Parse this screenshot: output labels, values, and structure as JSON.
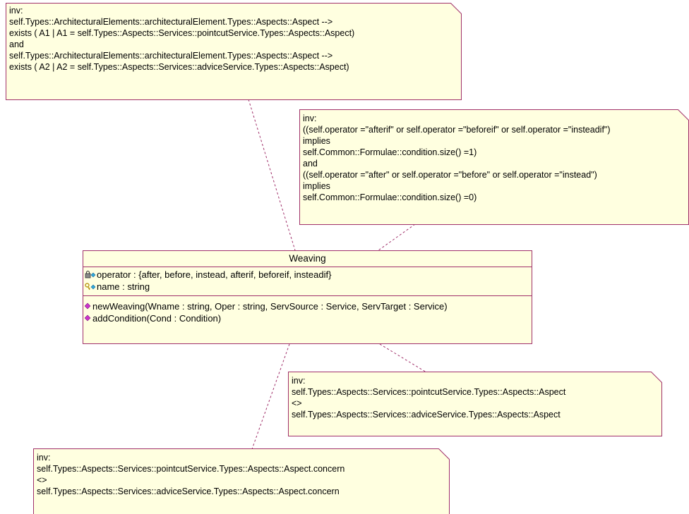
{
  "class": {
    "name": "Weaving",
    "attributes": [
      {
        "text": "operator : {after, before, instead, afterif, beforeif, insteadif}",
        "icon": "lock-attribute-icon"
      },
      {
        "text": "name : string",
        "icon": "key-attribute-icon"
      }
    ],
    "operations": [
      {
        "text": "newWeaving(Wname : string, Oper : string, ServSource : Service, ServTarget : Service)",
        "icon": "operation-icon"
      },
      {
        "text": "addCondition(Cond : Condition)",
        "icon": "operation-icon"
      }
    ]
  },
  "notes": {
    "note1": [
      "inv:",
      "self.Types::ArchitecturalElements::architecturalElement.Types::Aspects::Aspect -->",
      "exists ( A1 | A1 = self.Types::Aspects::Services::pointcutService.Types::Aspects::Aspect)",
      "and",
      "self.Types::ArchitecturalElements::architecturalElement.Types::Aspects::Aspect -->",
      "exists ( A2 | A2 = self.Types::Aspects::Services::adviceService.Types::Aspects::Aspect)"
    ],
    "note2": [
      "inv:",
      "((self.operator =\"afterif\" or self.operator =\"beforeif\" or self.operator =\"insteadif\")",
      "implies",
      "self.Common::Formulae::condition.size() =1)",
      "and",
      "((self.operator =\"after\" or self.operator =\"before\" or self.operator =\"instead\")",
      "implies",
      "self.Common::Formulae::condition.size() =0)"
    ],
    "note3": [
      "inv:",
      "self.Types::Aspects::Services::pointcutService.Types::Aspects::Aspect",
      "<>",
      "self.Types::Aspects::Services::adviceService.Types::Aspects::Aspect"
    ],
    "note4": [
      "inv:",
      "self.Types::Aspects::Services::pointcutService.Types::Aspects::Aspect.concern",
      "<>",
      "self.Types::Aspects::Services::adviceService.Types::Aspects::Aspect.concern"
    ]
  },
  "colors": {
    "border": "#a0306a",
    "fill": "#ffffe0",
    "operation": "#cc33cc",
    "attribute": "#33aadd"
  }
}
